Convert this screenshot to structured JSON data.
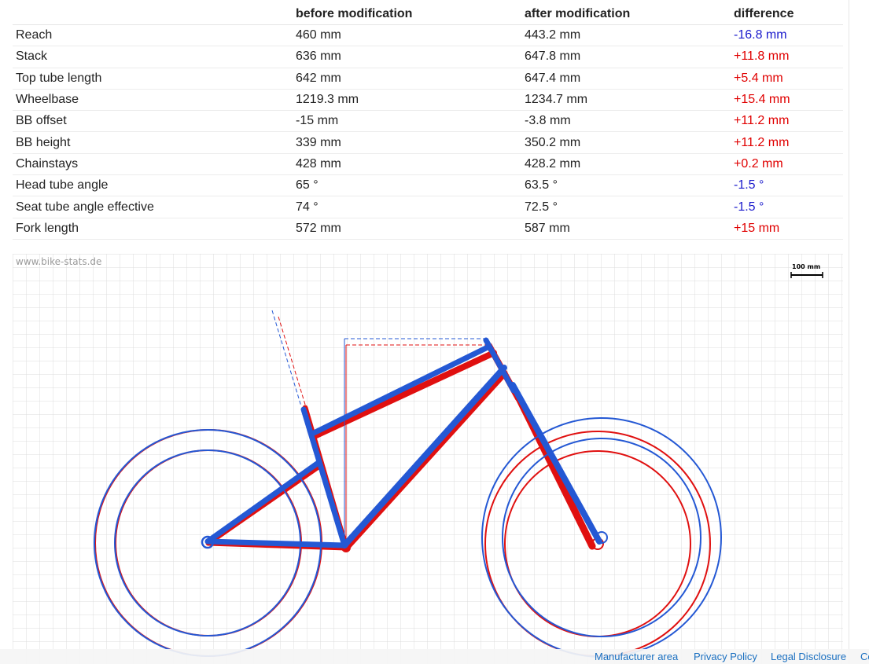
{
  "table": {
    "headers": [
      "",
      "before modification",
      "after modification",
      "difference"
    ],
    "rows": [
      {
        "label": "Reach",
        "before": "460 mm",
        "after": "443.2 mm",
        "diff": "-16.8 mm",
        "sign": "neg"
      },
      {
        "label": "Stack",
        "before": "636 mm",
        "after": "647.8 mm",
        "diff": "+11.8 mm",
        "sign": "pos"
      },
      {
        "label": "Top tube length",
        "before": "642 mm",
        "after": "647.4 mm",
        "diff": "+5.4 mm",
        "sign": "pos"
      },
      {
        "label": "Wheelbase",
        "before": "1219.3 mm",
        "after": "1234.7 mm",
        "diff": "+15.4 mm",
        "sign": "pos"
      },
      {
        "label": "BB offset",
        "before": "-15 mm",
        "after": "-3.8 mm",
        "diff": "+11.2 mm",
        "sign": "pos"
      },
      {
        "label": "BB height",
        "before": "339 mm",
        "after": "350.2 mm",
        "diff": "+11.2 mm",
        "sign": "pos"
      },
      {
        "label": "Chainstays",
        "before": "428 mm",
        "after": "428.2 mm",
        "diff": "+0.2 mm",
        "sign": "pos"
      },
      {
        "label": "Head tube angle",
        "before": "65 °",
        "after": "63.5 °",
        "diff": "-1.5 °",
        "sign": "neg"
      },
      {
        "label": "Seat tube angle effective",
        "before": "74 °",
        "after": "72.5 °",
        "diff": "-1.5 °",
        "sign": "neg"
      },
      {
        "label": "Fork length",
        "before": "572 mm",
        "after": "587 mm",
        "diff": "+15 mm",
        "sign": "pos"
      }
    ]
  },
  "diagram": {
    "watermark": "www.bike-stats.de",
    "scale_label": "100 mm",
    "colors": {
      "before": "#e01010",
      "after": "#2458d4",
      "grid": "#dcdcdc"
    }
  },
  "footer": {
    "links": [
      "Manufacturer area",
      "Privacy Policy",
      "Legal Disclosure",
      "Co"
    ]
  }
}
